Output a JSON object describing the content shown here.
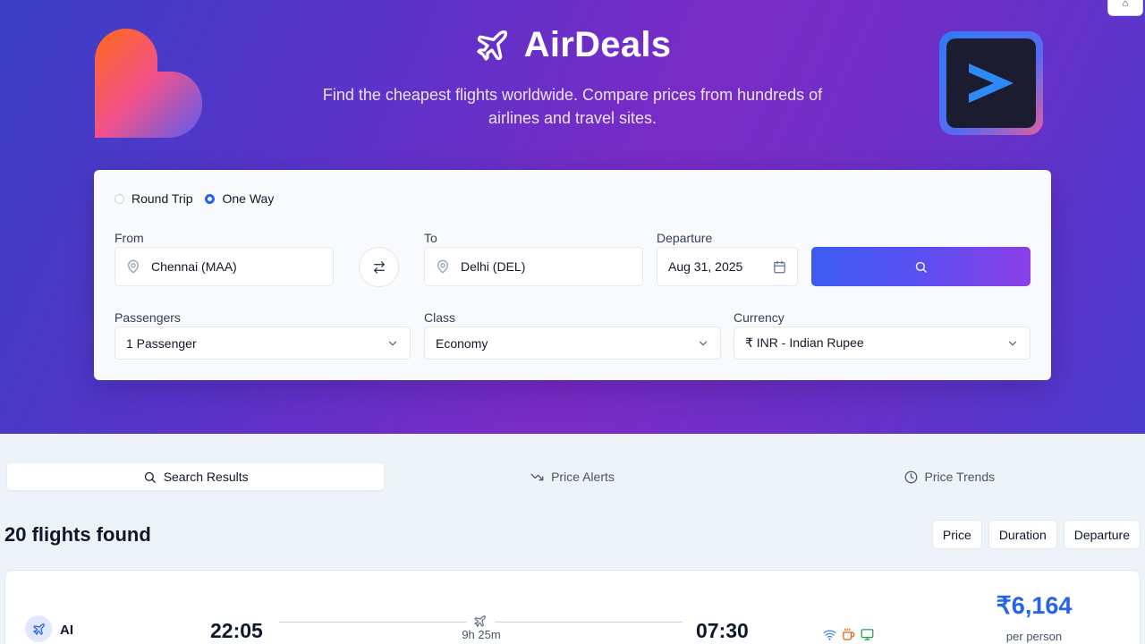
{
  "header": {
    "app_name": "AirDeals",
    "tagline": "Find the cheapest flights worldwide. Compare prices from hundreds of airlines and travel sites.",
    "corner_button_label": "⌂"
  },
  "search": {
    "trip_types": [
      {
        "label": "Round Trip",
        "selected": false
      },
      {
        "label": "One Way",
        "selected": true
      }
    ],
    "from_label": "From",
    "from_value": "Chennai (MAA)",
    "to_label": "To",
    "to_value": "Delhi (DEL)",
    "departure_label": "Departure",
    "departure_value": "Aug 31, 2025",
    "passengers_label": "Passengers",
    "passengers_value": "1 Passenger",
    "class_label": "Class",
    "class_value": "Economy",
    "currency_label": "Currency",
    "currency_value": "₹ INR - Indian Rupee"
  },
  "tabs": [
    {
      "label": "Search Results",
      "icon": "search-icon",
      "active": true
    },
    {
      "label": "Price Alerts",
      "icon": "trending-down-icon",
      "active": false
    },
    {
      "label": "Price Trends",
      "icon": "clock-icon",
      "active": false
    }
  ],
  "results": {
    "count_text": "20 flights found",
    "sort_options": [
      "Price",
      "Duration",
      "Departure"
    ]
  },
  "flights": [
    {
      "airline": "AI",
      "depart_time": "22:05",
      "arrive_time": "07:30",
      "duration": "9h 25m",
      "amenities": [
        "wifi-icon",
        "coffee-icon",
        "monitor-icon"
      ],
      "price": "₹6,164",
      "price_note": "per person"
    }
  ],
  "colors": {
    "accent": "#2563eb",
    "hero_start": "#3b3fc6",
    "hero_mid": "#7a2bc5"
  }
}
